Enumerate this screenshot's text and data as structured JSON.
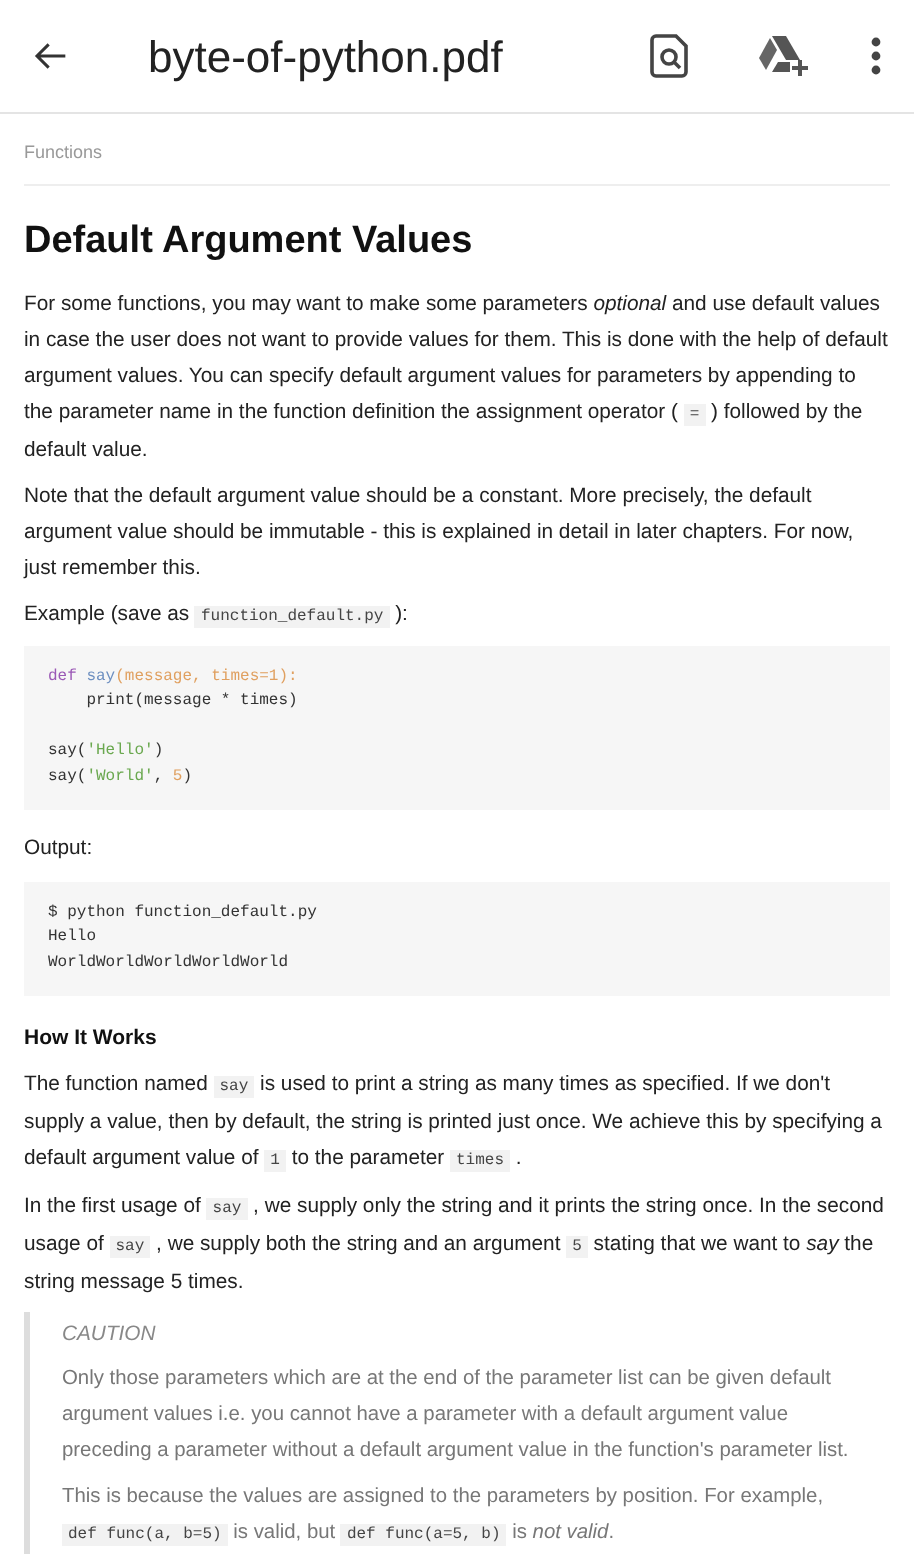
{
  "app_bar": {
    "title": "byte-of-python.pdf"
  },
  "breadcrumb": "Functions",
  "heading": "Default Argument Values",
  "intro": [
    [
      {
        "kind": "text",
        "text": "For some functions, you may want to make some parameters "
      },
      {
        "kind": "em",
        "text": "optional"
      },
      {
        "kind": "text",
        "text": " and use default values in case the user does not want to provide values for them. This is done with the help of default argument values. You can specify default argument values for parameters by appending to the parameter name in the function definition the assignment operator ( "
      },
      {
        "kind": "code",
        "text": "="
      },
      {
        "kind": "text",
        "text": " ) followed by the default value."
      }
    ],
    [
      {
        "kind": "text",
        "text": "Note that the default argument value should be a constant. More precisely, the default argument value should be immutable - this is explained in detail in later chapters. For now, just remember this."
      }
    ],
    [
      {
        "kind": "text",
        "text": "Example (save as "
      },
      {
        "kind": "code",
        "text": "function_default.py"
      },
      {
        "kind": "text",
        "text": " ):"
      }
    ]
  ],
  "example_code": [
    {
      "lines": [
        [
          {
            "kind": "keyword",
            "text": "def "
          },
          {
            "kind": "name",
            "text": "say"
          },
          {
            "kind": "param",
            "text": "(message, times=1):"
          }
        ],
        [
          {
            "kind": "plain",
            "text": "    print(message * times)"
          }
        ]
      ]
    },
    {
      "lines": [
        [
          {
            "kind": "plain",
            "text": "say("
          },
          {
            "kind": "string",
            "text": "'Hello'"
          },
          {
            "kind": "plain",
            "text": ")"
          }
        ],
        [
          {
            "kind": "plain",
            "text": "say("
          },
          {
            "kind": "string",
            "text": "'World'"
          },
          {
            "kind": "plain",
            "text": ", "
          },
          {
            "kind": "number",
            "text": "5"
          },
          {
            "kind": "plain",
            "text": ")"
          }
        ]
      ]
    }
  ],
  "output_label": "Output:",
  "output_code": [
    {
      "lines": [
        [
          {
            "kind": "plain",
            "text": "$ python function_default.py"
          }
        ],
        [
          {
            "kind": "plain",
            "text": "Hello"
          }
        ],
        [
          {
            "kind": "plain",
            "text": "WorldWorldWorldWorldWorld"
          }
        ]
      ]
    }
  ],
  "subheading": "How It Works",
  "explanation": [
    [
      {
        "kind": "text",
        "text": "The function named "
      },
      {
        "kind": "code",
        "text": "say"
      },
      {
        "kind": "text",
        "text": " is used to print a string as many times as specified. If we don't supply a value, then by default, the string is printed just once. We achieve this by specifying a default argument value of "
      },
      {
        "kind": "code",
        "text": "1"
      },
      {
        "kind": "text",
        "text": " to the parameter "
      },
      {
        "kind": "code",
        "text": "times"
      },
      {
        "kind": "text",
        "text": " ."
      }
    ],
    [
      {
        "kind": "text",
        "text": "In the first usage of "
      },
      {
        "kind": "code",
        "text": "say"
      },
      {
        "kind": "text",
        "text": " , we supply only the string and it prints the string once. In the second usage of "
      },
      {
        "kind": "code",
        "text": "say"
      },
      {
        "kind": "text",
        "text": " , we supply both the string and an argument "
      },
      {
        "kind": "code",
        "text": "5"
      },
      {
        "kind": "text",
        "text": " stating that we want to "
      },
      {
        "kind": "em",
        "text": "say"
      },
      {
        "kind": "text",
        "text": " the string message 5 times."
      }
    ]
  ],
  "caution": {
    "title": "CAUTION",
    "paragraphs": [
      [
        {
          "kind": "text",
          "text": "Only those parameters which are at the end of the parameter list can be given default argument values i.e. you cannot have a parameter with a default argument value preceding a parameter without a default argument value in the function's parameter list."
        }
      ],
      [
        {
          "kind": "text",
          "text": "This is because the values are assigned to the parameters by position. For example, "
        },
        {
          "kind": "code",
          "text": "def func(a, b=5)"
        },
        {
          "kind": "text",
          "text": " is valid, but "
        },
        {
          "kind": "code",
          "text": "def func(a=5, b)"
        },
        {
          "kind": "text",
          "text": " is "
        },
        {
          "kind": "em",
          "text": "not valid"
        },
        {
          "kind": "text",
          "text": "."
        }
      ]
    ]
  }
}
